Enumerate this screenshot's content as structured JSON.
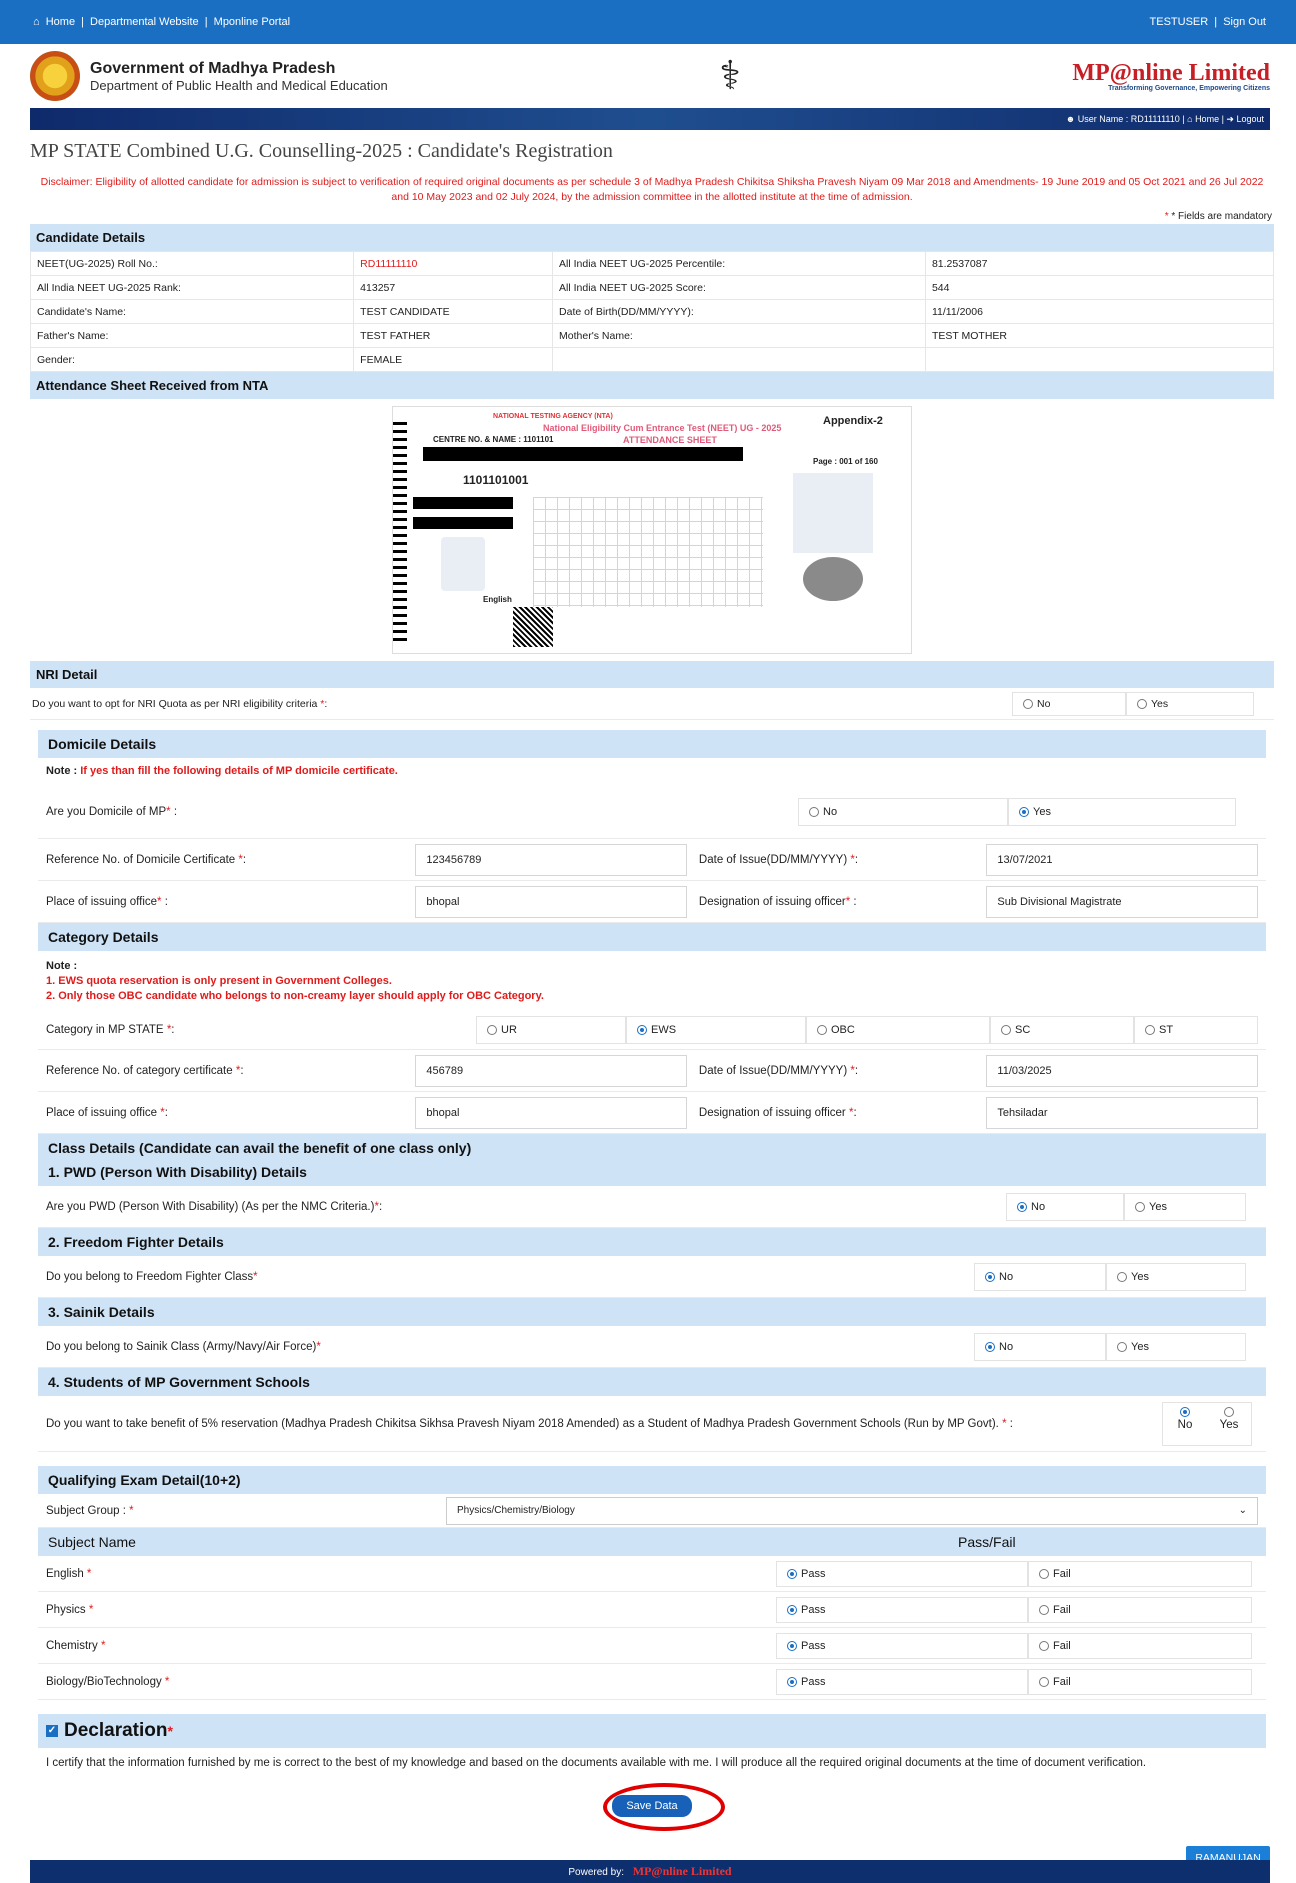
{
  "topbar": {
    "home": "Home",
    "dept": "Departmental Website",
    "portal": "Mponline Portal",
    "user": "TESTUSER",
    "signout": "Sign Out"
  },
  "header": {
    "gov_line1": "Government of Madhya Pradesh",
    "gov_line2": "Department of Public Health and Medical Education",
    "mponline": "MP@nline Limited",
    "mponline_tag": "Transforming Governance, Empowering Citizens"
  },
  "navstrip": {
    "user_label": "User Name : RD11111110",
    "home": "Home",
    "logout": "Logout"
  },
  "page_title": "MP STATE Combined U.G. Counselling-2025 : Candidate's Registration",
  "disclaimer": "Disclaimer: Eligibility of allotted candidate for admission is subject to verification of required original documents as per schedule 3 of Madhya Pradesh Chikitsa Shiksha Pravesh Niyam 09 Mar 2018 and Amendments- 19 June 2019 and 05 Oct 2021 and 26 Jul 2022 and 10 May 2023 and 02 July 2024, by the admission committee in the allotted institute at the time of admission.",
  "mandatory": "* Fields are mandatory",
  "candidate": {
    "heading": "Candidate Details",
    "rows": [
      [
        "NEET(UG-2025) Roll No.:",
        "RD11111110",
        "All India NEET UG-2025 Percentile:",
        "81.2537087"
      ],
      [
        "All India NEET UG-2025 Rank:",
        "413257",
        "All India NEET UG-2025 Score:",
        "544"
      ],
      [
        "Candidate's Name:",
        "TEST CANDIDATE",
        "Date of Birth(DD/MM/YYYY):",
        "11/11/2006"
      ],
      [
        "Father's Name:",
        "TEST FATHER",
        "Mother's Name:",
        "TEST MOTHER"
      ],
      [
        "Gender:",
        "FEMALE",
        "",
        ""
      ]
    ]
  },
  "attendance": {
    "heading": "Attendance Sheet Received from NTA",
    "nta": "NATIONAL TESTING AGENCY (NTA)",
    "exam": "National Eligibility Cum Entrance Test (NEET) UG - 2025",
    "sheet": "ATTENDANCE SHEET",
    "centre": "CENTRE NO. & NAME : 1101101",
    "appendix": "Appendix-2",
    "page": "Page : 001 of 160",
    "rollno": "1101101001",
    "medium": "English"
  },
  "nri": {
    "heading": "NRI Detail",
    "question": "Do you want to opt for NRI Quota as per NRI eligibility criteria",
    "no": "No",
    "yes": "Yes"
  },
  "domicile": {
    "heading": "Domicile Details",
    "note_label": "Note :",
    "note": "If yes than fill the following details of MP domicile certificate.",
    "question": "Are you Domicile of MP",
    "no": "No",
    "yes": "Yes",
    "ref_label": "Reference No. of Domicile Certificate",
    "ref": "123456789",
    "date_label": "Date of Issue(DD/MM/YYYY)",
    "date": "13/07/2021",
    "place_label": "Place of issuing office",
    "place": "bhopal",
    "desig_label": "Designation of issuing officer",
    "desig": "Sub Divisional Magistrate"
  },
  "category": {
    "heading": "Category Details",
    "note_label": "Note :",
    "note1": "1. EWS quota reservation is only present in Government Colleges.",
    "note2": "2. Only those OBC candidate who belongs to non-creamy layer should apply for OBC Category.",
    "label": "Category in MP STATE",
    "options": [
      "UR",
      "EWS",
      "OBC",
      "SC",
      "ST"
    ],
    "selected": "EWS",
    "ref_label": "Reference No. of category certificate",
    "ref": "456789",
    "date_label": "Date of Issue(DD/MM/YYYY)",
    "date": "11/03/2025",
    "place_label": "Place of issuing office",
    "place": "bhopal",
    "desig_label": "Designation of issuing officer",
    "desig": "Tehsiladar"
  },
  "class": {
    "heading": "Class Details (Candidate can avail the benefit of one class only)",
    "pwd_heading": "1. PWD (Person With Disability) Details",
    "pwd_q": "Are you PWD (Person With Disability) (As per the NMC Criteria.)",
    "ff_heading": "2. Freedom Fighter Details",
    "ff_q": "Do you belong to Freedom Fighter Class",
    "sainik_heading": "3. Sainik Details",
    "sainik_q": "Do you belong to Sainik Class (Army/Navy/Air Force)",
    "govt_heading": "4. Students of MP Government Schools",
    "govt_q": "Do you want to take benefit of 5% reservation (Madhya Pradesh Chikitsa Sikhsa Pravesh Niyam 2018 Amended) as a Student of Madhya Pradesh Government Schools (Run by MP Govt).",
    "no": "No",
    "yes": "Yes"
  },
  "qualifying": {
    "heading": "Qualifying Exam Detail(10+2)",
    "group_label": "Subject Group :",
    "group": "Physics/Chemistry/Biology",
    "col_subject": "Subject Name",
    "col_pass": "Pass/Fail",
    "pass": "Pass",
    "fail": "Fail",
    "subjects": [
      "English",
      "Physics",
      "Chemistry",
      "Biology/BioTechnology"
    ]
  },
  "declaration": {
    "heading": "Declaration",
    "text": "I certify that the information furnished by me is correct to the best of my knowledge and based on the documents available with me. I will produce all the required original documents at the time of document verification.",
    "save": "Save Data"
  },
  "footer": {
    "powered": "Powered by:",
    "brand": "MP@nline Limited",
    "ramanujan": "RAMANUJAN"
  },
  "colors": {
    "topbar": "#1b6fc2",
    "section": "#cfe3f7",
    "required": "#e01b1b",
    "footer": "#0e2f6d",
    "highlight": "#e00000"
  }
}
